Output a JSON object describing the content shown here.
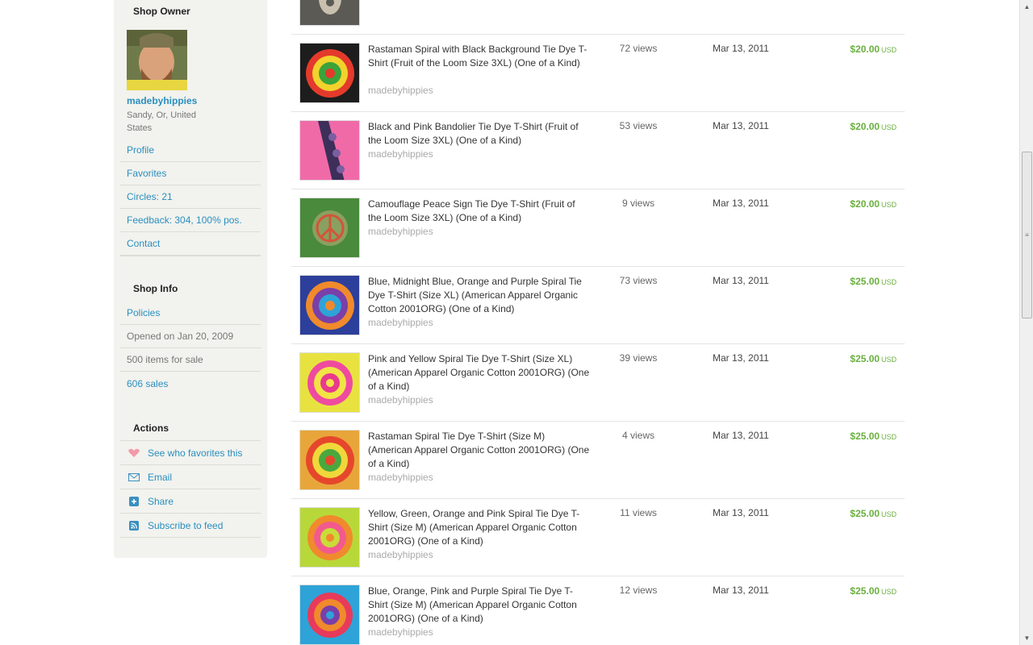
{
  "sidebar": {
    "owner_title": "Shop Owner",
    "owner_name": "madebyhippies",
    "owner_location": "Sandy, Or, United States",
    "owner_links": [
      {
        "label": "Profile"
      },
      {
        "label": "Favorites"
      },
      {
        "label": "Circles: 21"
      },
      {
        "label": "Feedback: 304, 100% pos."
      },
      {
        "label": "Contact"
      }
    ],
    "info_title": "Shop Info",
    "info_items": [
      {
        "label": "Policies"
      },
      {
        "label": "Opened on Jan 20, 2009"
      },
      {
        "label": "500 items for sale"
      },
      {
        "label": "606 sales"
      }
    ],
    "actions_title": "Actions",
    "actions": [
      {
        "label": "See who favorites this",
        "icon": "heart-icon"
      },
      {
        "label": "Email",
        "icon": "envelope-icon"
      },
      {
        "label": "Share",
        "icon": "plus-icon"
      },
      {
        "label": "Subscribe to feed",
        "icon": "rss-icon"
      }
    ]
  },
  "listings": [
    {
      "title": "",
      "seller": "",
      "views": "",
      "date": "",
      "price": "",
      "currency": ""
    },
    {
      "title": "Rastaman Spiral with Black Background Tie Dye T-Shirt (Fruit of the Loom Size 3XL) (One of a Kind)",
      "seller": "madebyhippies",
      "views": "72 views",
      "date": "Mar 13, 2011",
      "price": "$20.00",
      "currency": "USD"
    },
    {
      "title": "Black and Pink Bandolier Tie Dye T-Shirt (Fruit of the Loom Size 3XL) (One of a Kind)",
      "seller": "madebyhippies",
      "views": "53 views",
      "date": "Mar 13, 2011",
      "price": "$20.00",
      "currency": "USD"
    },
    {
      "title": "Camouflage Peace Sign Tie Dye T-Shirt (Fruit of the Loom Size 3XL) (One of a Kind)",
      "seller": "madebyhippies",
      "views": "9 views",
      "date": "Mar 13, 2011",
      "price": "$20.00",
      "currency": "USD"
    },
    {
      "title": "Blue, Midnight Blue, Orange and Purple Spiral Tie Dye T-Shirt (Size XL) (American Apparel Organic Cotton 2001ORG) (One of a Kind)",
      "seller": "madebyhippies",
      "views": "73 views",
      "date": "Mar 13, 2011",
      "price": "$25.00",
      "currency": "USD"
    },
    {
      "title": "Pink and Yellow Spiral Tie Dye T-Shirt (Size XL) (American Apparel Organic Cotton 2001ORG) (One of a Kind)",
      "seller": "madebyhippies",
      "views": "39 views",
      "date": "Mar 13, 2011",
      "price": "$25.00",
      "currency": "USD"
    },
    {
      "title": "Rastaman Spiral Tie Dye T-Shirt (Size M) (American Apparel Organic Cotton 2001ORG) (One of a Kind)",
      "seller": "madebyhippies",
      "views": "4 views",
      "date": "Mar 13, 2011",
      "price": "$25.00",
      "currency": "USD"
    },
    {
      "title": "Yellow, Green, Orange and Pink Spiral Tie Dye T-Shirt (Size M) (American Apparel Organic Cotton 2001ORG) (One of a Kind)",
      "seller": "madebyhippies",
      "views": "11 views",
      "date": "Mar 13, 2011",
      "price": "$25.00",
      "currency": "USD"
    },
    {
      "title": "Blue, Orange, Pink and Purple Spiral Tie Dye T-Shirt (Size M) (American Apparel Organic Cotton 2001ORG) (One of a Kind)",
      "seller": "madebyhippies",
      "views": "12 views",
      "date": "Mar 13, 2011",
      "price": "$25.00",
      "currency": "USD"
    }
  ],
  "colors": {
    "link": "#2a8fbf",
    "price": "#6bb03f",
    "sidebar_bg": "#f2f2ee"
  }
}
